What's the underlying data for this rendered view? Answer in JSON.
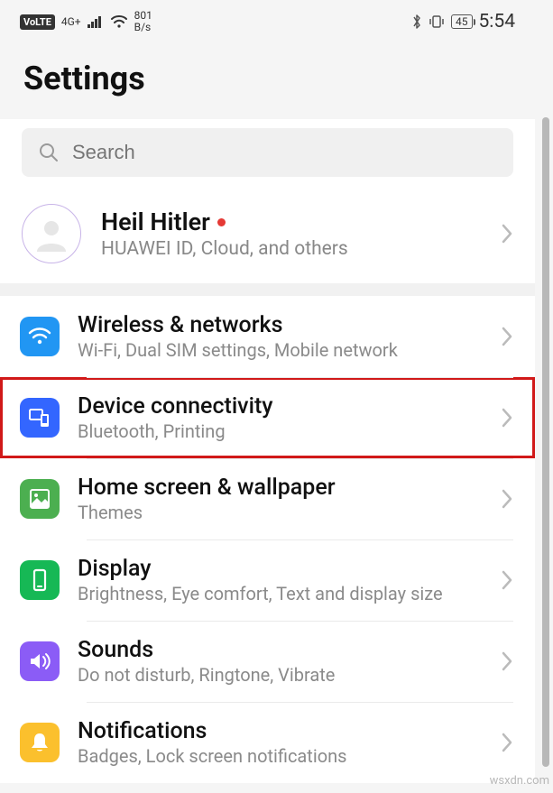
{
  "statusbar": {
    "volte": "VoLTE",
    "network_type": "4G+",
    "net_speed_value": "801",
    "net_speed_unit": "B/s",
    "battery": "45",
    "time": "5:54"
  },
  "header": {
    "title": "Settings"
  },
  "search": {
    "placeholder": "Search"
  },
  "account": {
    "name": "Heil Hitler",
    "subtitle": "HUAWEI ID, Cloud, and others"
  },
  "items": [
    {
      "title": "Wireless & networks",
      "subtitle": "Wi-Fi, Dual SIM settings, Mobile network",
      "icon": "wifi",
      "color": "c-blue1",
      "highlight": false
    },
    {
      "title": "Device connectivity",
      "subtitle": "Bluetooth, Printing",
      "icon": "devices",
      "color": "c-blue2",
      "highlight": true
    },
    {
      "title": "Home screen & wallpaper",
      "subtitle": "Themes",
      "icon": "image",
      "color": "c-green1",
      "highlight": false
    },
    {
      "title": "Display",
      "subtitle": "Brightness, Eye comfort, Text and display size",
      "icon": "display",
      "color": "c-green2",
      "highlight": false
    },
    {
      "title": "Sounds",
      "subtitle": "Do not disturb, Ringtone, Vibrate",
      "icon": "sound",
      "color": "c-purple",
      "highlight": false
    },
    {
      "title": "Notifications",
      "subtitle": "Badges, Lock screen notifications",
      "icon": "bell",
      "color": "c-yellow",
      "highlight": false
    }
  ],
  "watermark": "wsxdn.com"
}
